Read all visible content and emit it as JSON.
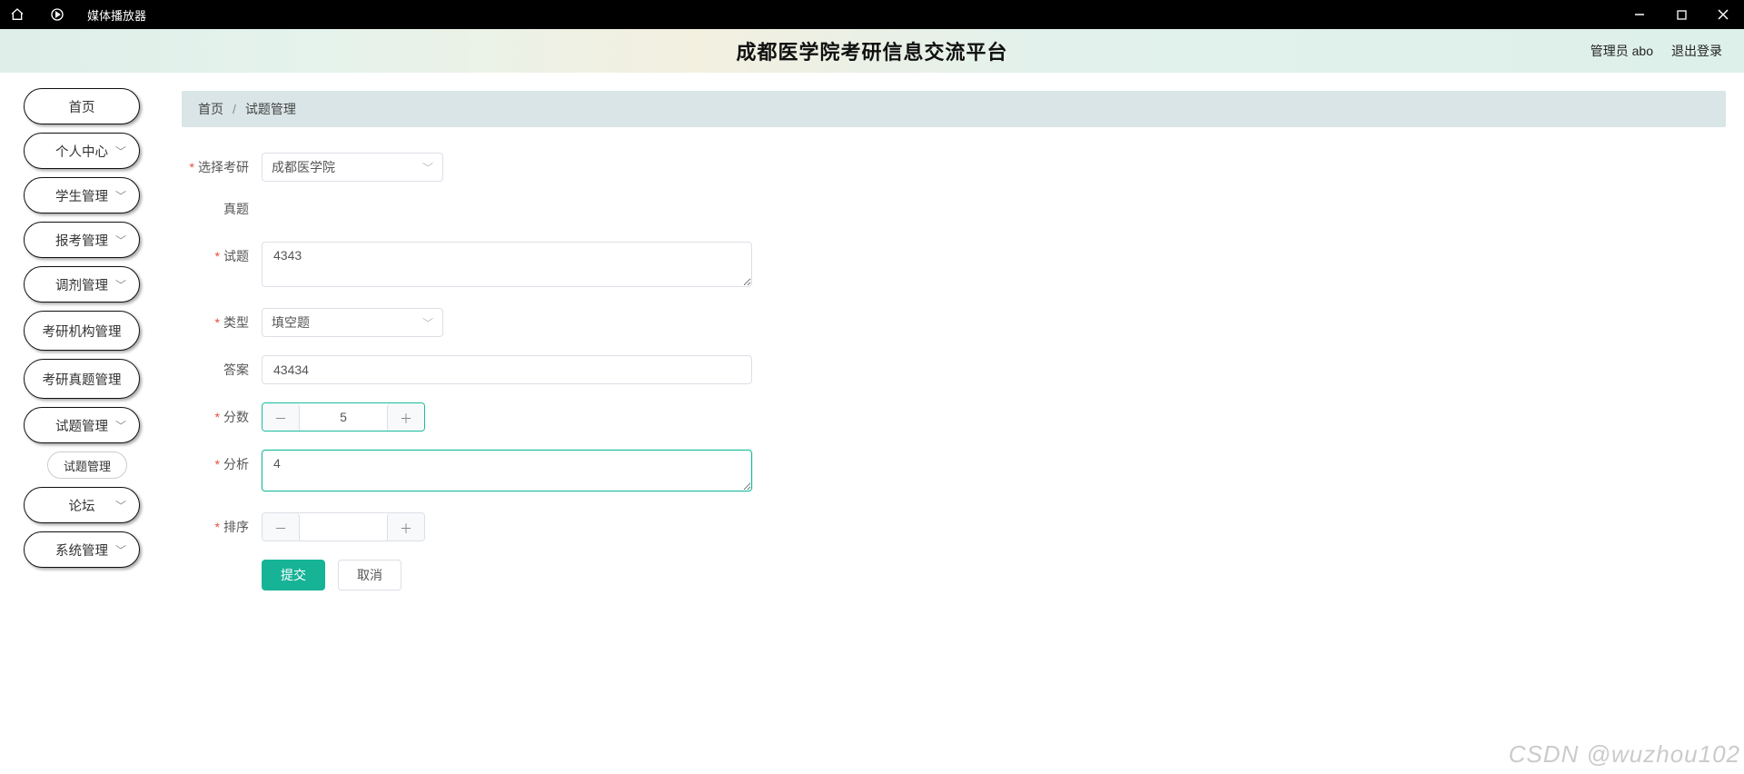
{
  "window": {
    "app_name": "媒体播放器"
  },
  "header": {
    "title": "成都医学院考研信息交流平台",
    "admin_label": "管理员 abo",
    "logout_label": "退出登录"
  },
  "breadcrumb": {
    "home": "首页",
    "current": "试题管理"
  },
  "sidebar": {
    "items": [
      {
        "label": "首页",
        "expandable": false
      },
      {
        "label": "个人中心",
        "expandable": true
      },
      {
        "label": "学生管理",
        "expandable": true
      },
      {
        "label": "报考管理",
        "expandable": true
      },
      {
        "label": "调剂管理",
        "expandable": true
      },
      {
        "label": "考研机构管理",
        "expandable": false
      },
      {
        "label": "考研真题管理",
        "expandable": false
      },
      {
        "label": "试题管理",
        "expandable": true
      },
      {
        "label": "论坛",
        "expandable": true
      },
      {
        "label": "系统管理",
        "expandable": true
      }
    ],
    "sub_item": "试题管理"
  },
  "form": {
    "labels": {
      "select_exam": "选择考研",
      "real_question": "真题",
      "question": "试题",
      "type": "类型",
      "answer": "答案",
      "score": "分数",
      "analysis": "分析",
      "order": "排序"
    },
    "values": {
      "select_exam": "成都医学院",
      "question": "4343",
      "type": "填空题",
      "answer": "43434",
      "score": "5",
      "analysis": "4",
      "order": ""
    },
    "buttons": {
      "submit": "提交",
      "cancel": "取消"
    }
  },
  "watermark": "CSDN @wuzhou102"
}
